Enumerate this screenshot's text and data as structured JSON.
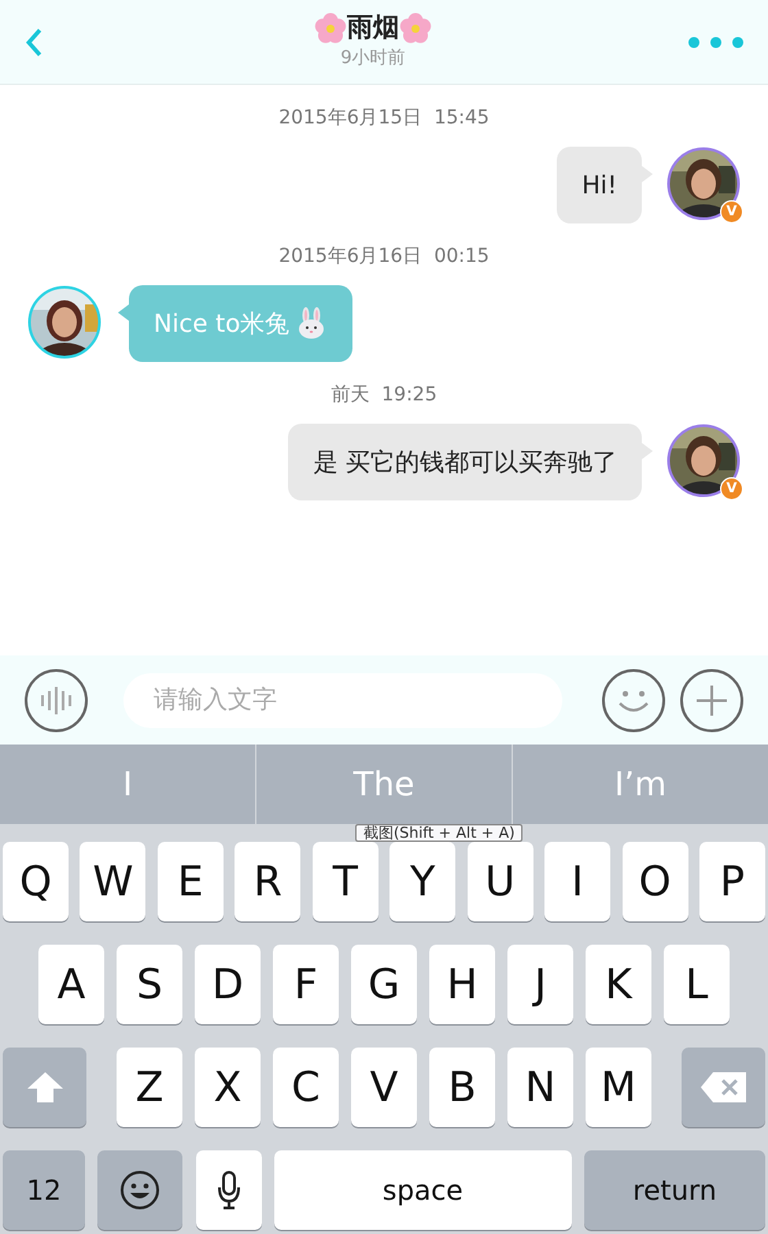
{
  "header": {
    "title": "雨烟",
    "subtitle": "9小时前"
  },
  "messages": [
    {
      "kind": "sent",
      "timestamp": "2015年6月15日  15:45",
      "text": "Hi!",
      "trailing_icon": false,
      "badge": "V"
    },
    {
      "kind": "received",
      "timestamp": "2015年6月16日  00:15",
      "text": "Nice to米兔",
      "trailing_icon": true
    },
    {
      "kind": "sent",
      "timestamp": "前天  19:25",
      "text": "是 买它的钱都可以买奔驰了",
      "trailing_icon": false,
      "badge": "V"
    }
  ],
  "input": {
    "placeholder": "请输入文字"
  },
  "keyboard": {
    "suggestions": [
      "I",
      "The",
      "I’m"
    ],
    "rows": [
      {
        "keys": [
          {
            "kind": "letter",
            "label": "Q"
          },
          {
            "kind": "letter",
            "label": "W"
          },
          {
            "kind": "letter",
            "label": "E"
          },
          {
            "kind": "letter",
            "label": "R"
          },
          {
            "kind": "letter",
            "label": "T"
          },
          {
            "kind": "letter",
            "label": "Y"
          },
          {
            "kind": "letter",
            "label": "U"
          },
          {
            "kind": "letter",
            "label": "I"
          },
          {
            "kind": "letter",
            "label": "O"
          },
          {
            "kind": "letter",
            "label": "P"
          }
        ]
      },
      {
        "keys": [
          {
            "kind": "letter",
            "label": "A"
          },
          {
            "kind": "letter",
            "label": "S"
          },
          {
            "kind": "letter",
            "label": "D"
          },
          {
            "kind": "letter",
            "label": "F"
          },
          {
            "kind": "letter",
            "label": "G"
          },
          {
            "kind": "letter",
            "label": "H"
          },
          {
            "kind": "letter",
            "label": "J"
          },
          {
            "kind": "letter",
            "label": "K"
          },
          {
            "kind": "letter",
            "label": "L"
          }
        ]
      },
      {
        "keys": [
          {
            "kind": "shift"
          },
          {
            "kind": "letter",
            "label": "Z"
          },
          {
            "kind": "letter",
            "label": "X"
          },
          {
            "kind": "letter",
            "label": "C"
          },
          {
            "kind": "letter",
            "label": "V"
          },
          {
            "kind": "letter",
            "label": "B"
          },
          {
            "kind": "letter",
            "label": "N"
          },
          {
            "kind": "letter",
            "label": "M"
          },
          {
            "kind": "delete"
          }
        ]
      },
      {
        "keys": [
          {
            "kind": "numbers",
            "label": "12"
          },
          {
            "kind": "emoji"
          },
          {
            "kind": "mic"
          },
          {
            "kind": "space",
            "label": "space"
          },
          {
            "kind": "return",
            "label": "return"
          }
        ]
      }
    ]
  },
  "tooltip": {
    "text": "截图(Shift + Alt + A)"
  }
}
